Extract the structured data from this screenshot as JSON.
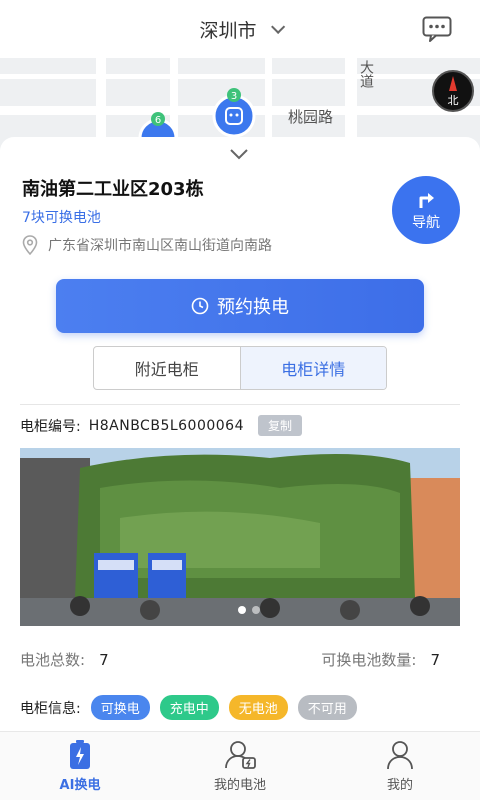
{
  "header": {
    "city": "深圳市"
  },
  "map": {
    "labels": [
      "大道",
      "桃园路",
      "北"
    ],
    "pins": [
      {
        "count": "3",
        "color": "#4aa36c"
      },
      {
        "count": "6",
        "color": "#3ec27a"
      }
    ]
  },
  "station": {
    "name": "南油第二工业区203栋",
    "available": "7块可换电池",
    "address": "广东省深圳市南山区南山街道向南路",
    "nav_label": "导航"
  },
  "actions": {
    "reserve_label": "预约换电"
  },
  "tabs": [
    {
      "label": "附近电柜",
      "active": false
    },
    {
      "label": "电柜详情",
      "active": true
    }
  ],
  "detail": {
    "serial_label": "电柜编号:",
    "serial_value": "H8ANBCB5L6000064",
    "copy_label": "复制",
    "photo_page": "1 / 2",
    "total_label": "电池总数:",
    "total_value": "7",
    "swappable_label": "可换电池数量:",
    "swappable_value": "7",
    "legend_label": "电柜信息:",
    "legend": [
      {
        "label": "可换电",
        "color": "#4a86ee"
      },
      {
        "label": "充电中",
        "color": "#2ec98a"
      },
      {
        "label": "无电池",
        "color": "#f5b72a"
      },
      {
        "label": "不可用",
        "color": "#b8bcc2"
      }
    ]
  },
  "bottom_nav": [
    {
      "label": "AI换电",
      "active": true
    },
    {
      "label": "我的电池",
      "active": false
    },
    {
      "label": "我的",
      "active": false
    }
  ],
  "colors": {
    "accent": "#3b73ef"
  }
}
